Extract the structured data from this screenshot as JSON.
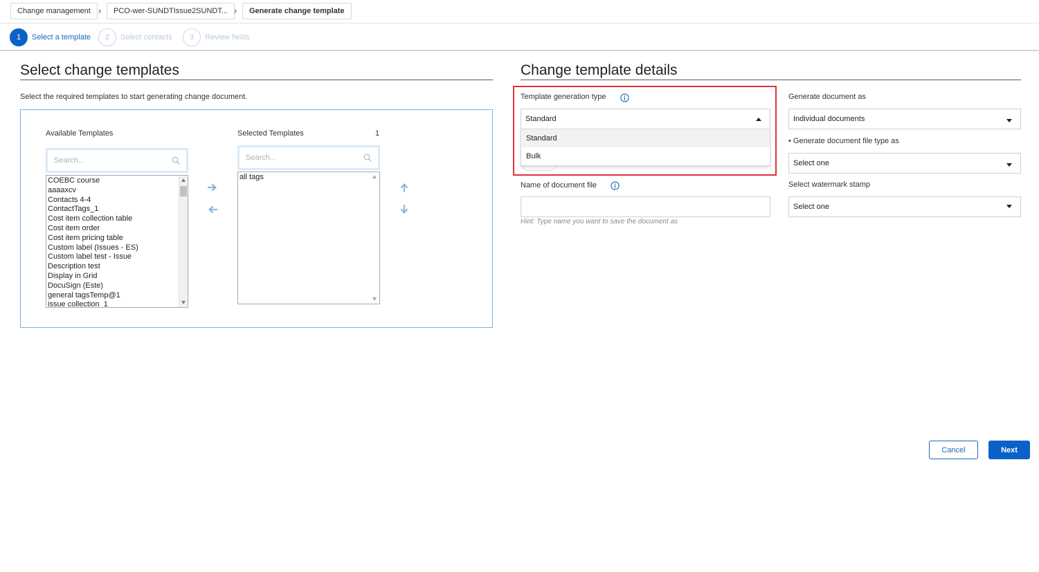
{
  "breadcrumb": {
    "items": [
      {
        "label": "Change management"
      },
      {
        "label": "PCO-wer-SUNDTIssue2SUNDT..."
      },
      {
        "label": "Generate change template"
      }
    ],
    "separator": "›"
  },
  "stepper": {
    "steps": [
      {
        "number": "1",
        "label": "Select a template",
        "state": "active"
      },
      {
        "number": "2",
        "label": "Select contacts",
        "state": "inactive"
      },
      {
        "number": "3",
        "label": "Review fields",
        "state": "inactive"
      }
    ]
  },
  "left_panel": {
    "title": "Select change templates",
    "description": "Select the required templates to start generating change document.",
    "available": {
      "label": "Available Templates",
      "search_placeholder": "Search...",
      "items": [
        "COEBC course",
        "aaaaxcv",
        "Contacts 4-4",
        "ContactTags_1",
        "Cost item collection table",
        "Cost item order",
        "Cost item pricing table",
        "Custom label (Issues - ES)",
        "Custom label test - Issue",
        "Description test",
        "Display in Grid",
        "DocuSign (Este)",
        "general tagsTemp@1",
        "issue collection_1"
      ]
    },
    "selected": {
      "label": "Selected Templates",
      "count": "1",
      "search_placeholder": "Search...",
      "items": [
        "all tags"
      ]
    }
  },
  "right_panel": {
    "title": "Change template details",
    "generation_type": {
      "label": "Template generation type",
      "value": "Standard",
      "options": [
        "Standard",
        "Bulk"
      ]
    },
    "document_name": {
      "label": "Name of document file",
      "value": "",
      "hint": "Hint: Type name you want to save the document as"
    },
    "generate_as": {
      "label": "Generate document as",
      "value": "Individual documents"
    },
    "file_type": {
      "required_marker": "•",
      "label": "Generate document file type as",
      "value": "Select one"
    },
    "watermark": {
      "label": "Select watermark stamp",
      "value": "Select one"
    }
  },
  "footer": {
    "cancel_label": "Cancel",
    "next_label": "Next"
  },
  "colors": {
    "primary": "#0a62c8",
    "link_blue": "#1a67b8",
    "highlight_red": "#e0303a",
    "box_border": "#7aaee0",
    "inactive_step": "#b8cbe0",
    "arrow_blue": "#8fb6de"
  }
}
